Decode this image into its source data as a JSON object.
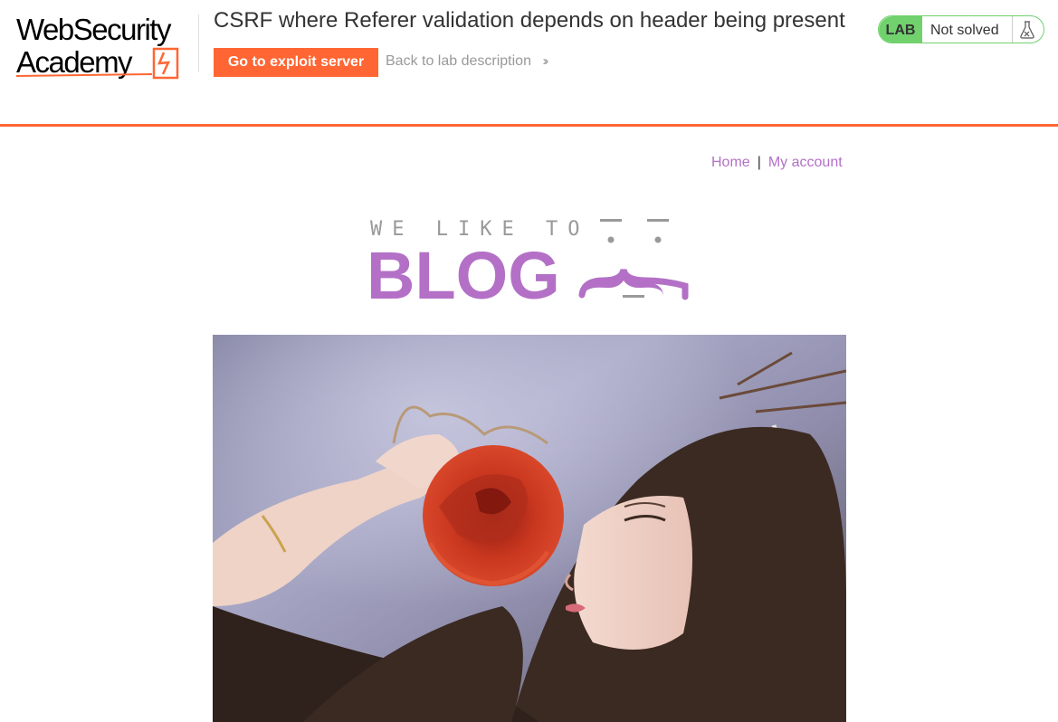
{
  "logo": {
    "line1": "WebSecurity",
    "line2": "Academy"
  },
  "lab": {
    "title": "CSRF where Referer validation depends on header being present",
    "exploit_button": "Go to exploit server",
    "back_link": "Back to lab description",
    "status_badge": "LAB",
    "status_text": "Not solved",
    "flask_icon": "flask-icon"
  },
  "nav": {
    "home": "Home",
    "separator": "|",
    "account": "My account"
  },
  "banner": {
    "tagline": "WE LIKE TO",
    "word": "BLOG"
  },
  "colors": {
    "accent": "#ff6633",
    "status_green": "#70d16d",
    "link_purple": "#b370c6",
    "banner_gray": "#999999"
  },
  "hero": {
    "icon": "hero-photo-rose"
  }
}
